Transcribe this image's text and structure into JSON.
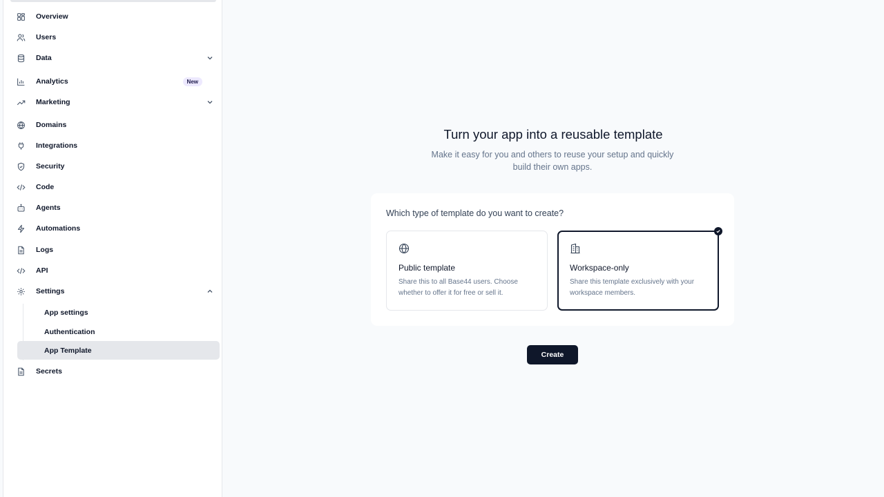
{
  "sidebar": {
    "items": [
      {
        "label": "Overview",
        "icon": "grid-icon"
      },
      {
        "label": "Users",
        "icon": "users-icon"
      },
      {
        "label": "Data",
        "icon": "database-icon"
      },
      {
        "label": "Analytics",
        "icon": "bar-chart-icon",
        "badge": "New"
      },
      {
        "label": "Marketing",
        "icon": "trending-up-icon"
      },
      {
        "label": "Domains",
        "icon": "globe-icon"
      },
      {
        "label": "Integrations",
        "icon": "plug-icon"
      },
      {
        "label": "Security",
        "icon": "shield-icon"
      },
      {
        "label": "Code",
        "icon": "code-icon"
      },
      {
        "label": "Agents",
        "icon": "bot-icon"
      },
      {
        "label": "Automations",
        "icon": "zap-icon"
      },
      {
        "label": "Logs",
        "icon": "file-icon"
      },
      {
        "label": "API",
        "icon": "code-icon"
      },
      {
        "label": "Settings",
        "icon": "gear-icon"
      },
      {
        "label": "Secrets",
        "icon": "file-icon"
      }
    ],
    "settings_sub": [
      {
        "label": "App settings"
      },
      {
        "label": "Authentication"
      },
      {
        "label": "App Template",
        "active": true
      }
    ]
  },
  "main": {
    "title": "Turn your app into a reusable template",
    "subtitle": "Make it easy for you and others to reuse your setup and quickly build their own apps.",
    "question": "Which type of template do you want to create?",
    "options": [
      {
        "title": "Public template",
        "description": "Share this to all Base44 users. Choose whether to offer it for free or sell it.",
        "icon": "globe-icon",
        "selected": false
      },
      {
        "title": "Workspace-only",
        "description": "Share this template exclusively with your workspace members.",
        "icon": "building-icon",
        "selected": true
      }
    ],
    "create_label": "Create"
  },
  "colors": {
    "accent": "#0f172a",
    "badge_bg": "#ede9fe",
    "active_bg": "#e5e7eb",
    "page_bg": "#f8fafc"
  }
}
